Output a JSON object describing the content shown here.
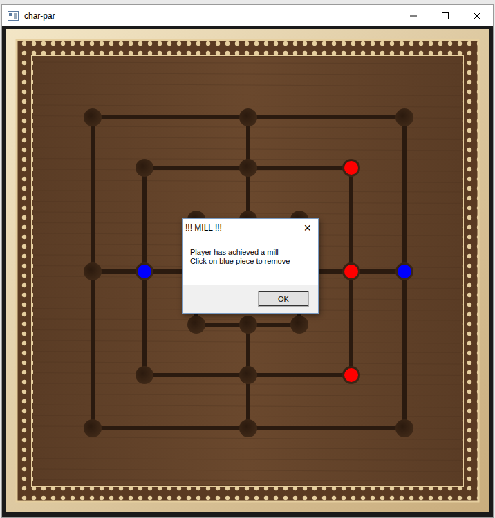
{
  "window": {
    "title": "char-par"
  },
  "board": {
    "pieces": [
      {
        "ring": "middle",
        "spot": "top-right",
        "color": "#ff0000"
      },
      {
        "ring": "middle",
        "spot": "right",
        "color": "#ff0000"
      },
      {
        "ring": "middle",
        "spot": "bottom-right",
        "color": "#ff0000"
      },
      {
        "ring": "middle",
        "spot": "left",
        "color": "#0000ff"
      },
      {
        "ring": "outer",
        "spot": "right",
        "color": "#0000ff"
      }
    ]
  },
  "dialog": {
    "title": "!!! MILL !!!",
    "close": "×",
    "lines": [
      "Player has achieved a mill",
      "Click on blue piece to remove"
    ],
    "buttons": [
      "OK"
    ]
  }
}
